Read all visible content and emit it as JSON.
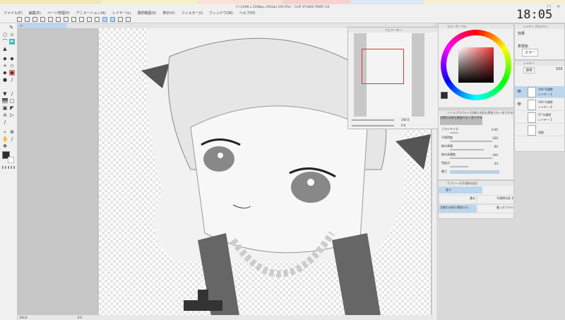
{
  "window": {
    "title": "ｼﾘ (1498 x 2288px 350dpi 100.0%) - CLIP STUDIO PAINT EX",
    "controls": "_ □ ×"
  },
  "clock": "18:05",
  "menu": [
    "ファイル(F)",
    "編集(E)",
    "ページ管理(P)",
    "アニメーション(A)",
    "レイヤー(L)",
    "選択範囲(S)",
    "表示(V)",
    "フィルター(I)",
    "ウィンドウ(W)",
    "ヘルプ(H)"
  ],
  "canvas_tab": "ｼﾘ",
  "status": {
    "zoom": "100.0",
    "angle": "0.0"
  },
  "navigator": {
    "title": "ナビゲーター",
    "zoom": "100.0",
    "rotation": "0.0"
  },
  "color_panel": {
    "title": "カラーサークル",
    "main_color": "#2c2c2c",
    "sub_color": "#ffffff"
  },
  "layer_property": {
    "title": "レイヤープロパティ",
    "effect_label": "効果",
    "expression_label": "表現色",
    "expression_value": "カラー"
  },
  "layers": {
    "title": "レイヤー",
    "blend": "通常",
    "opacity": "100",
    "items": [
      {
        "info": "100 %通常",
        "name": "レイヤー 2",
        "selected": true
      },
      {
        "info": "100 %通常",
        "name": "レイヤー 3",
        "selected": false
      },
      {
        "info": "57 %通常",
        "name": "レイヤー 1",
        "selected": false
      },
      {
        "info": "",
        "name": "用紙",
        "selected": false
      }
    ]
  },
  "tool_property": {
    "title": "ツールプロパティ[主線も水彩も厚塗りも一本でやる影付けのブラシ]",
    "brush_name": "主線も水彩も厚塗りも一本でやる影付けのブラシ",
    "rows": [
      {
        "label": "ブラシサイズ",
        "value": "0.40",
        "fill": 0.2
      },
      {
        "label": "不透明度",
        "value": "100",
        "fill": 1.0
      },
      {
        "label": "絵の具量",
        "value": "80",
        "fill": 0.8
      },
      {
        "label": "絵の具濃度",
        "value": "100",
        "fill": 1.0
      },
      {
        "label": "色延び",
        "value": "44",
        "fill": 0.44
      },
      {
        "label": "硬さ",
        "value": "",
        "fill": 0.7
      }
    ]
  },
  "subtool": {
    "title": "サブツール[不透明水彩]",
    "group": "塗り",
    "items": [
      "濃る",
      "不透明水彩 2",
      "主線も水彩も厚塗りも…",
      "髪っかブラシ"
    ]
  }
}
